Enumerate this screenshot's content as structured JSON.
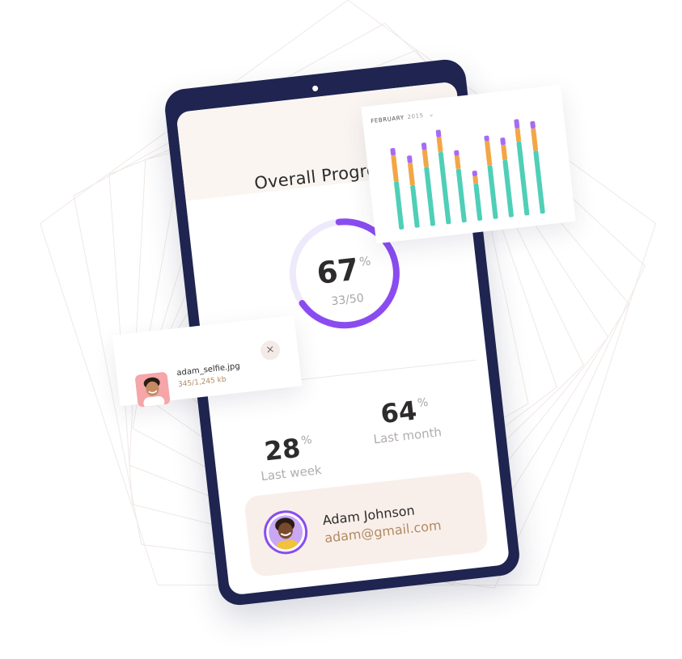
{
  "progress": {
    "title": "Overall Progress",
    "percent": 67,
    "percent_unit": "%",
    "count": "33/50"
  },
  "stats": {
    "week": {
      "value": "28",
      "unit": "%",
      "label": "Last week"
    },
    "month": {
      "value": "64",
      "unit": "%",
      "label": "Last month"
    }
  },
  "user": {
    "name": "Adam Johnson",
    "email": "adam@gmail.com"
  },
  "file": {
    "name": "adam_selfie.jpg",
    "size": "345/1,245 kb",
    "close_label": "×"
  },
  "colors": {
    "accent": "#8a4cf0",
    "ring_track": "#eeeafb",
    "device": "#1f2550",
    "bar_base": "#4fcfb8",
    "bar_mid": "#f3a646",
    "bar_top": "#a56cf2"
  },
  "chart_data": {
    "type": "bar",
    "stacked": true,
    "header_month": "FEBRUARY",
    "header_year": "2015",
    "series": [
      {
        "name": "",
        "color": "#4fcfb8",
        "values": [
          52,
          46,
          64,
          78,
          58,
          40,
          58,
          62,
          80,
          68
        ]
      },
      {
        "name": "",
        "color": "#f3a646",
        "values": [
          28,
          24,
          18,
          16,
          14,
          8,
          26,
          16,
          14,
          24
        ]
      },
      {
        "name": "",
        "color": "#a56cf2",
        "values": [
          8,
          8,
          8,
          8,
          6,
          6,
          6,
          8,
          10,
          8
        ]
      }
    ]
  }
}
